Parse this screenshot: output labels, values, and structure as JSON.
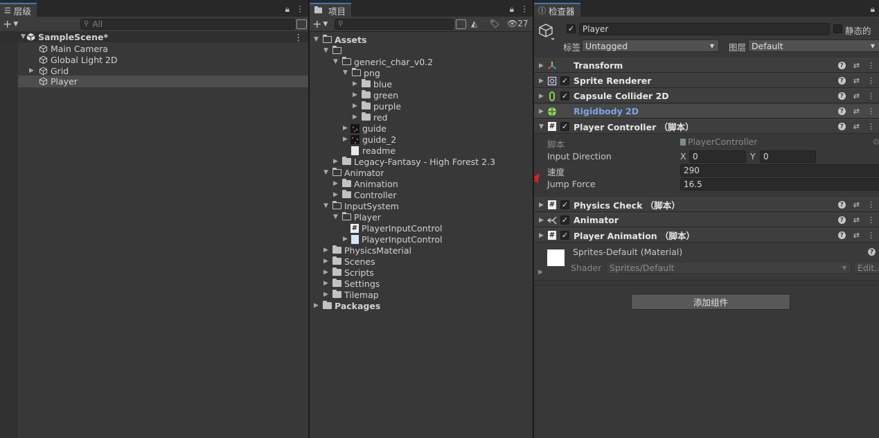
{
  "hierarchy": {
    "tab_label": "层级",
    "search_placeholder": "All",
    "scene": "SampleScene*",
    "objects": [
      "Main Camera",
      "Global Light 2D",
      "Grid",
      "Player"
    ]
  },
  "project": {
    "tab_label": "项目",
    "hidden_count": "27",
    "tree": {
      "assets": "Assets",
      "generic_char": "generic_char_v0.2",
      "png": "png",
      "blue": "blue",
      "green": "green",
      "purple": "purple",
      "red": "red",
      "guide": "guide",
      "guide_2": "guide_2",
      "readme": "readme",
      "legacy": "Legacy-Fantasy - High Forest 2.3",
      "animator": "Animator",
      "animation": "Animation",
      "controller": "Controller",
      "inputsystem": "InputSystem",
      "player": "Player",
      "pic_script": "PlayerInputControl",
      "pic_asset": "PlayerInputControl",
      "physicsmaterial": "PhysicsMaterial",
      "scenes": "Scenes",
      "scripts": "Scripts",
      "settings": "Settings",
      "tilemap": "Tilemap",
      "packages": "Packages"
    }
  },
  "inspector": {
    "tab_label": "检查器",
    "object_name": "Player",
    "static_label": "静态的",
    "tag_label": "标签",
    "tag_value": "Untagged",
    "layer_label": "图层",
    "layer_value": "Default",
    "components": {
      "transform": "Transform",
      "sprite_renderer": "Sprite Renderer",
      "capsule_collider": "Capsule Collider 2D",
      "rigidbody": "Rigidbody 2D",
      "player_controller": "Player Controller （脚本）",
      "physics_check": "Physics Check （脚本）",
      "animator": "Animator",
      "player_animation": "Player Animation （脚本）"
    },
    "player_controller_fields": {
      "script_label": "脚本",
      "script_value": "PlayerController",
      "input_direction_label": "Input Direction",
      "x_label": "X",
      "x_value": "0",
      "y_label": "Y",
      "y_value": "0",
      "speed_label": "速度",
      "speed_value": "290",
      "jump_force_label": "Jump Force",
      "jump_force_value": "16.5"
    },
    "material": {
      "name": "Sprites-Default (Material)",
      "shader_label": "Shader",
      "shader_value": "Sprites/Default",
      "edit_label": "Edit..."
    },
    "add_component_label": "添加组件"
  },
  "colors": {
    "accent_blue": "#3a79bb",
    "rigidbody_text": "#7aa6e6",
    "arrow_red": "#e02020"
  }
}
